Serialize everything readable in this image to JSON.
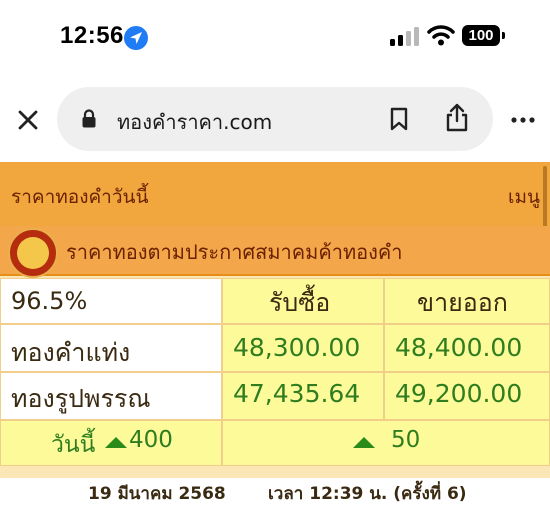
{
  "status_bar": {
    "time": "12:56",
    "battery": "100"
  },
  "browser": {
    "url": "ทองคำราคา.com"
  },
  "page": {
    "title": "ราคาทองคำวันนี้",
    "menu_label": "เมนู",
    "association_title": "ราคาทองตามประกาศสมาคมค้าทองคำ"
  },
  "table": {
    "purity": "96.5%",
    "buy_header": "รับซื้อ",
    "sell_header": "ขายออก",
    "rows": [
      {
        "label": "ทองคำแท่ง",
        "buy": "48,300.00",
        "sell": "48,400.00"
      },
      {
        "label": "ทองรูปพรรณ",
        "buy": "47,435.64",
        "sell": "49,200.00"
      }
    ],
    "today_label": "วันนี้",
    "today_change": "400",
    "change_amount": "50",
    "date": "19 มีนาคม 2568",
    "time_info": "เวลา 12:39 น.  (ครั้งที่ 6)"
  },
  "colors": {
    "accent_orange": "#f1a73e",
    "price_green": "#2f7d1f",
    "highlight_yellow": "#fdfa9a",
    "location_blue": "#1f7cf5"
  },
  "icons": [
    "location-arrow-icon",
    "cellular-signal-icon",
    "wifi-icon",
    "battery-icon",
    "close-icon",
    "lock-icon",
    "bookmark-icon",
    "share-icon",
    "more-icon",
    "up-arrow-icon"
  ]
}
